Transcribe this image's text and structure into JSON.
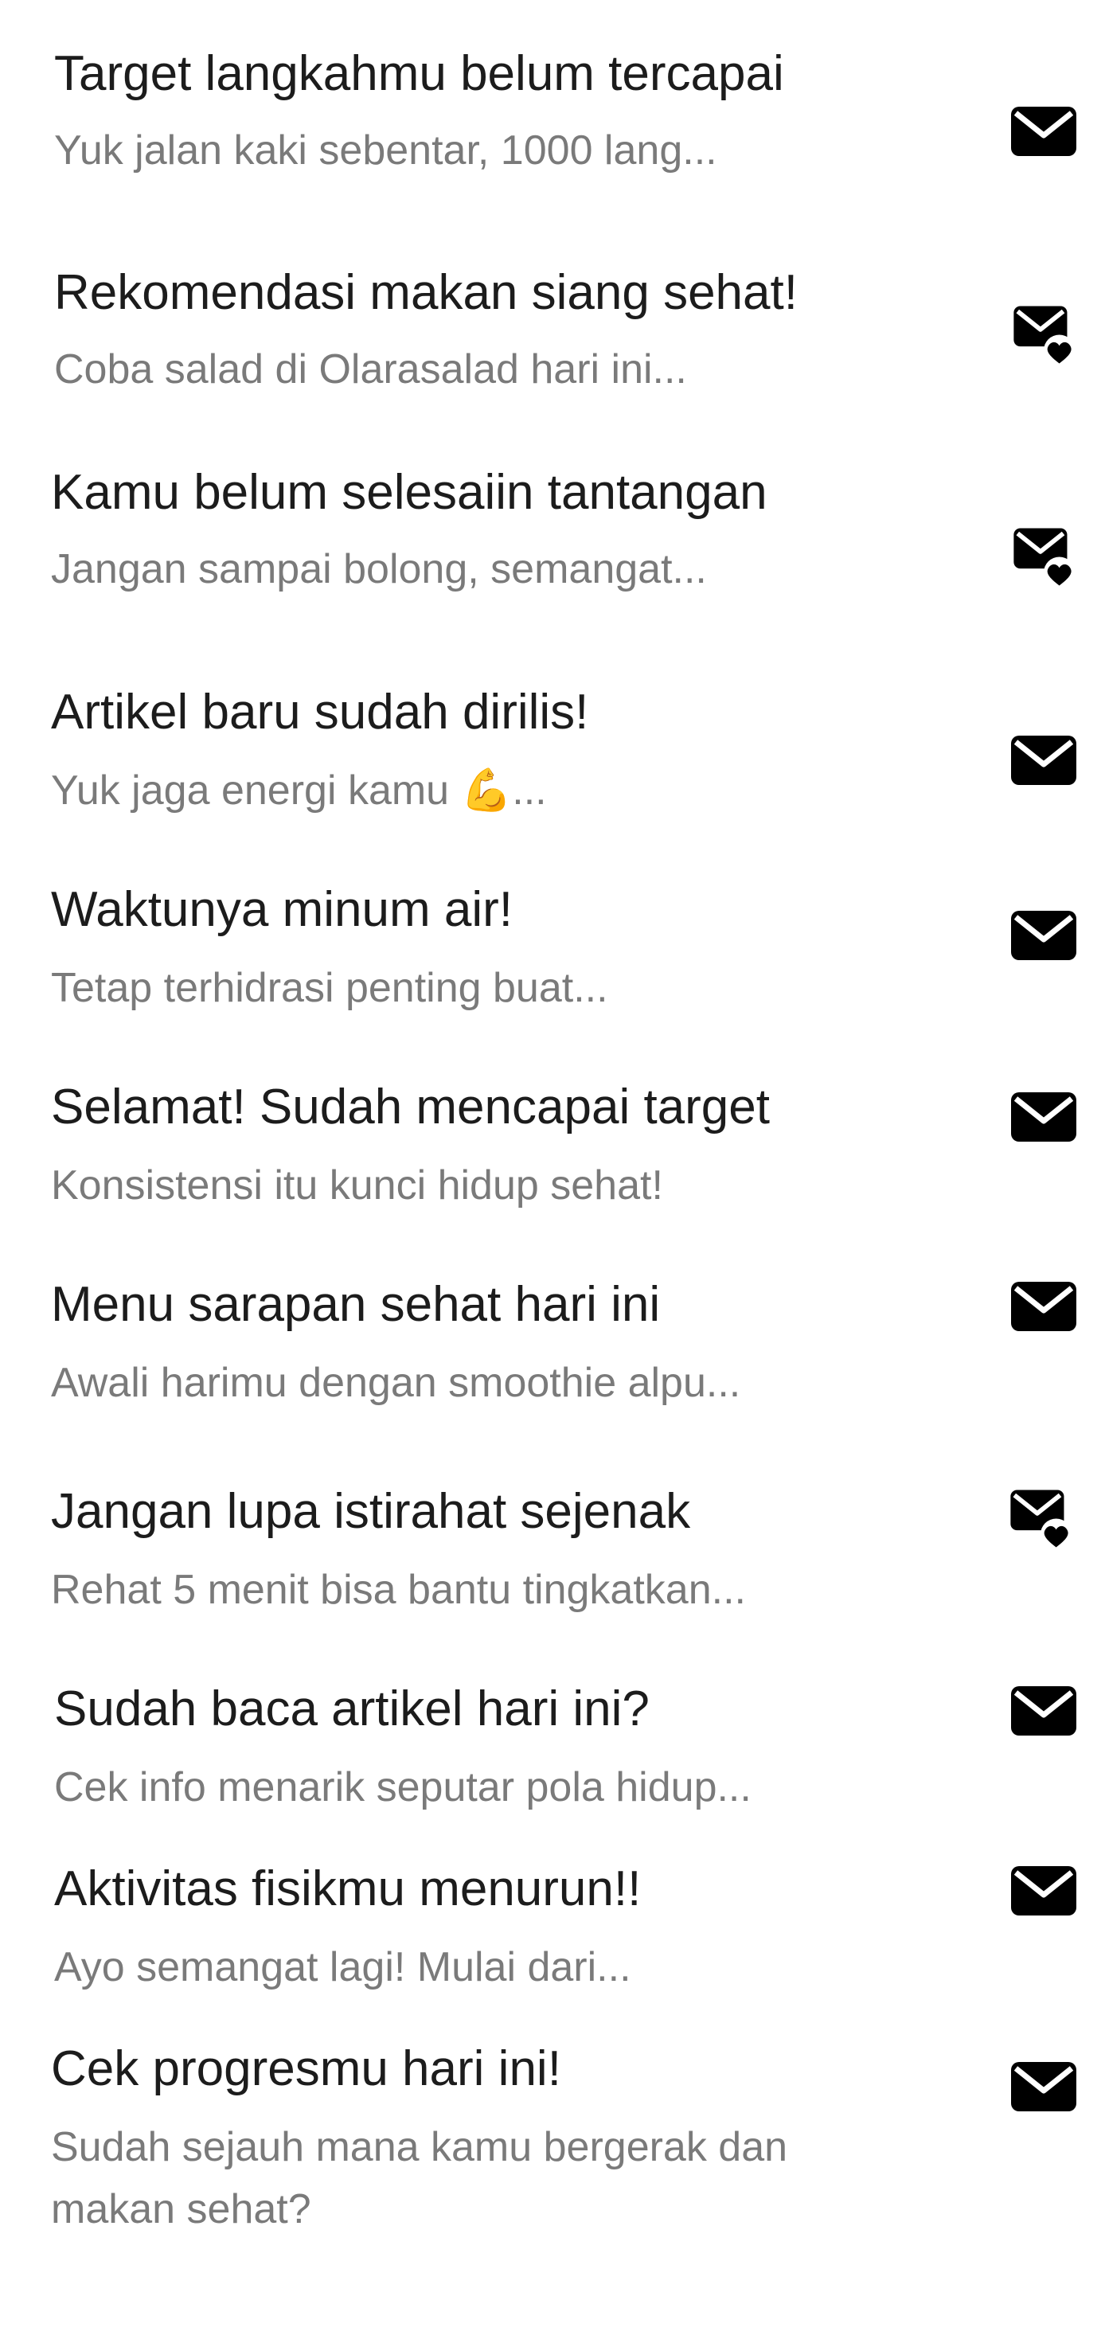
{
  "notifications": [
    {
      "title": "Target langkahmu belum tercapai",
      "subtitle": "Yuk jalan kaki sebentar, 1000 lang...",
      "icon": "mail-icon"
    },
    {
      "title": "Rekomendasi makan siang sehat!",
      "subtitle": "Coba salad di Olarasalad hari ini...",
      "icon": "mail-heart-icon"
    },
    {
      "title": "Kamu belum selesaiin tantangan",
      "subtitle": "Jangan sampai bolong, semangat...",
      "icon": "mail-heart-icon"
    },
    {
      "title": "Artikel baru sudah dirilis!",
      "subtitle": "Yuk jaga energi kamu 💪...",
      "icon": "mail-icon"
    },
    {
      "title": "Waktunya minum air!",
      "subtitle": "Tetap terhidrasi penting buat...",
      "icon": "mail-icon"
    },
    {
      "title": "Selamat! Sudah mencapai target",
      "subtitle": "Konsistensi itu kunci hidup sehat!",
      "icon": "mail-icon"
    },
    {
      "title": "Menu sarapan sehat hari ini",
      "subtitle": "Awali harimu dengan smoothie alpu...",
      "icon": "mail-icon"
    },
    {
      "title": "Jangan lupa istirahat sejenak",
      "subtitle": "Rehat 5 menit bisa bantu tingkatkan...",
      "icon": "mail-heart-icon"
    },
    {
      "title": "Sudah baca artikel hari ini?",
      "subtitle": "Cek info menarik seputar pola hidup...",
      "icon": "mail-icon"
    },
    {
      "title": "Aktivitas fisikmu menurun!!",
      "subtitle": "Ayo semangat lagi! Mulai dari...",
      "icon": "mail-icon"
    },
    {
      "title": "Cek progresmu hari ini!",
      "subtitle": "Sudah sejauh mana kamu bergerak dan makan sehat?",
      "icon": "mail-icon"
    }
  ]
}
